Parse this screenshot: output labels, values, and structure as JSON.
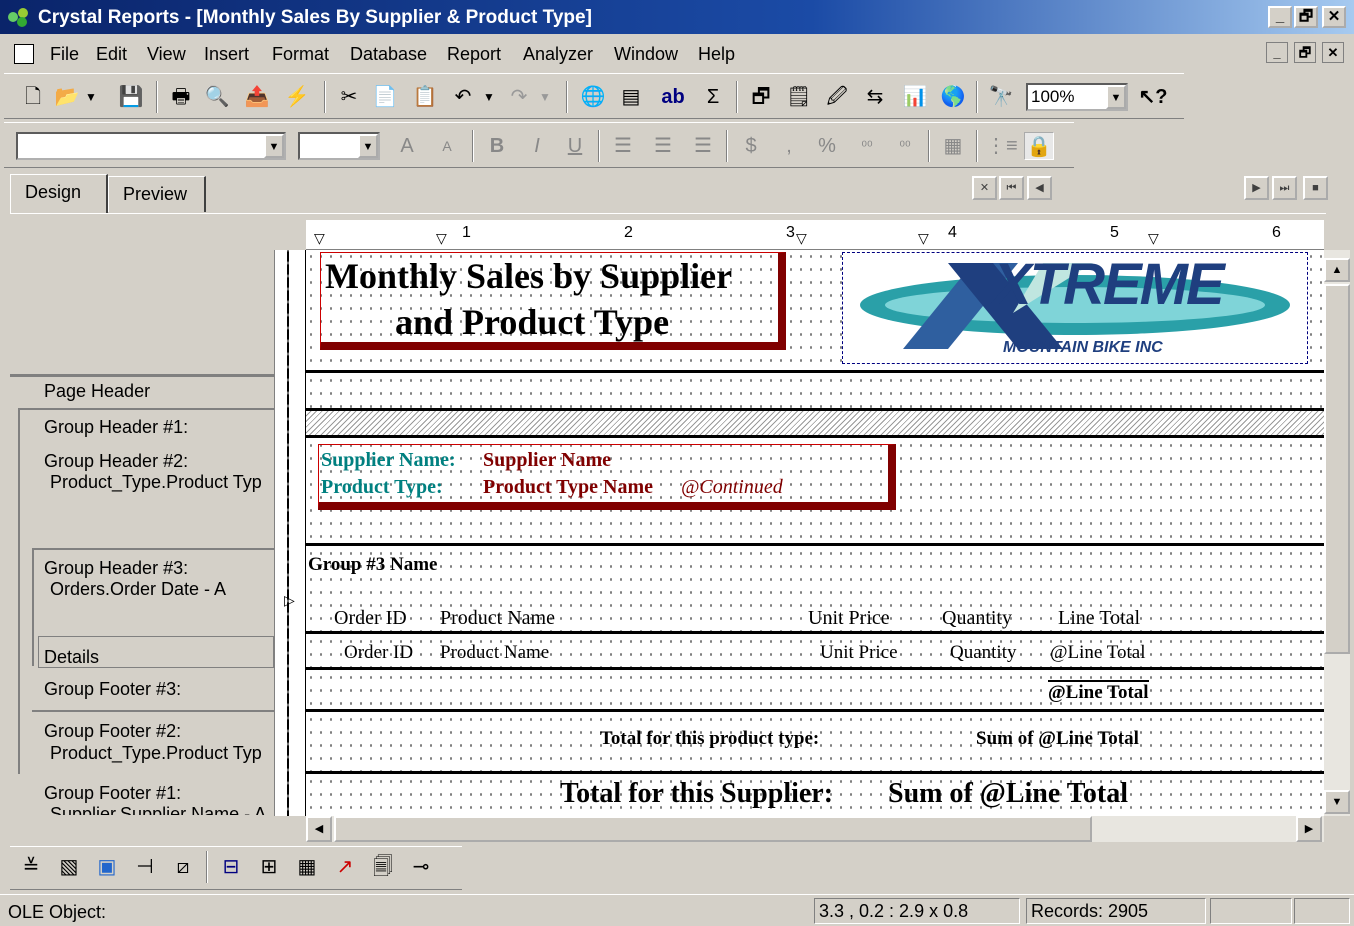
{
  "window": {
    "title": "Crystal Reports - [Monthly Sales By Supplier & Product Type]",
    "controls": [
      "_",
      "🗗",
      "✕"
    ]
  },
  "menu": {
    "items": [
      "File",
      "Edit",
      "View",
      "Insert",
      "Format",
      "Database",
      "Report",
      "Analyzer",
      "Window",
      "Help"
    ]
  },
  "toolbar": {
    "zoom": "100%"
  },
  "tabs": [
    "Design",
    "Preview"
  ],
  "ruler": {
    "labels": [
      "1",
      "2",
      "3",
      "4",
      "5",
      "6"
    ]
  },
  "sections": {
    "page_header": "Page Header",
    "gh1": "Group Header #1:",
    "gh2": "Group Header #2:",
    "gh2_sub": "Product_Type.Product Typ",
    "gh3": "Group Header #3:",
    "gh3_sub": "Orders.Order Date - A",
    "details": "Details",
    "gf3": "Group Footer #3:",
    "gf2": "Group Footer #2:",
    "gf2_sub": "Product_Type.Product Typ",
    "gf1": "Group Footer #1:",
    "gf1_sub": "Supplier.Supplier Name - A"
  },
  "report": {
    "title_line1": "Monthly Sales by Supplier",
    "title_line2": "and Product Type",
    "logo_main": "XTREME",
    "logo_sub": "MOUNTAIN BIKE INC",
    "supplier_label": "Supplier Name:",
    "supplier_field": "Supplier Name",
    "product_type_label": "Product Type:",
    "product_type_field": "Product Type Name",
    "continued": "@Continued",
    "group3_name": "Group #3 Name",
    "col_order_id": "Order ID",
    "col_product_name": "Product Name",
    "col_unit_price": "Unit Price",
    "col_quantity": "Quantity",
    "col_line_total": "Line Total",
    "det_order_id": "Order ID",
    "det_product_name": "Product Name",
    "det_unit_price": "Unit Price",
    "det_quantity": "Quantity",
    "det_line_total": "@Line Total",
    "gf3_total": "@Line Total",
    "gf2_label": "Total for this product type:",
    "gf2_sum": "Sum of @Line Total",
    "gf1_label": "Total for this Supplier:",
    "gf1_sum": "Sum of @Line Total"
  },
  "status": {
    "object": "OLE Object:",
    "position": "3.3 , 0.2 : 2.9 x 0.8",
    "records": "Records:  2905"
  },
  "colors": {
    "title_bar": "#0a246a",
    "dark_red": "#800000",
    "teal": "#008080"
  }
}
